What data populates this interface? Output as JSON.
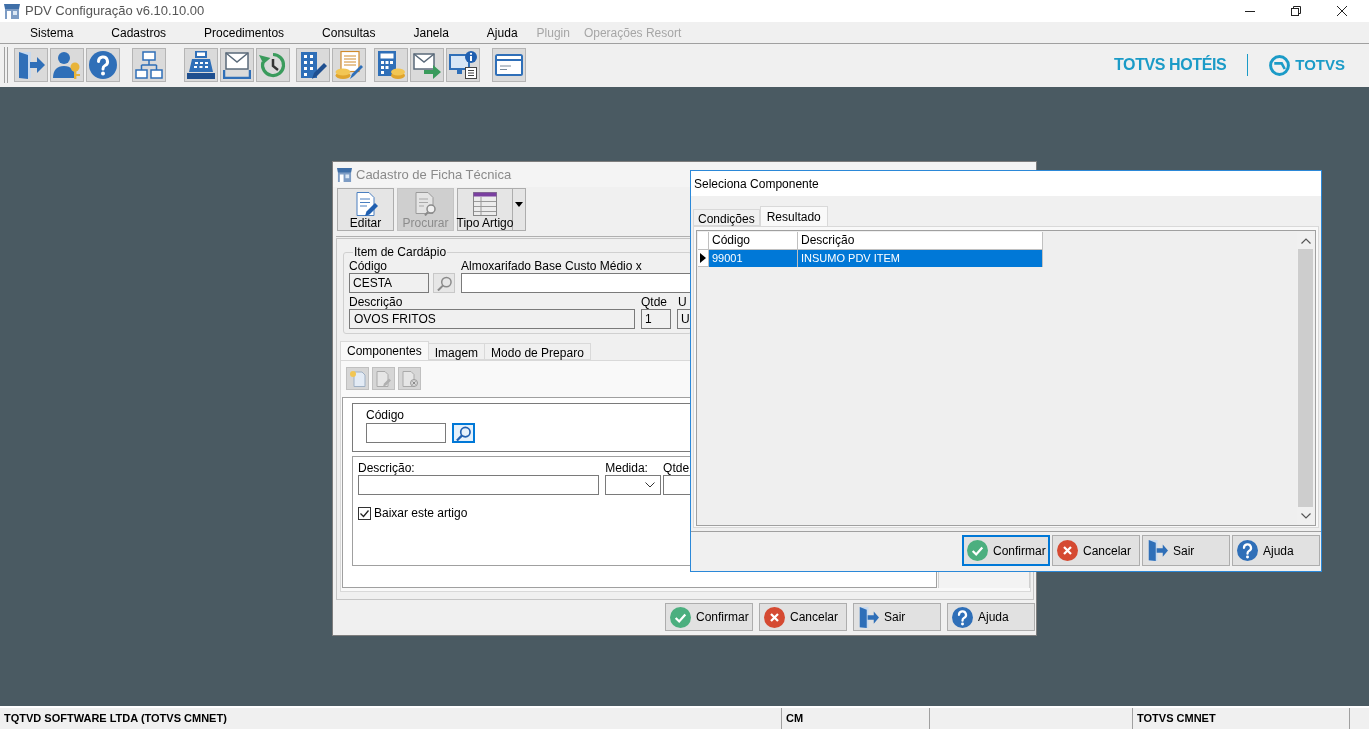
{
  "app_window": {
    "title": "PDV Configuração v6.10.10.00"
  },
  "menu": [
    {
      "label": "Sistema",
      "disabled": false
    },
    {
      "label": "Cadastros",
      "disabled": false
    },
    {
      "label": "Procedimentos",
      "disabled": false
    },
    {
      "label": "Consultas",
      "disabled": false
    },
    {
      "label": "Janela",
      "disabled": false
    },
    {
      "label": "Ajuda",
      "disabled": false
    },
    {
      "label": "Plugin",
      "disabled": true
    },
    {
      "label": "Operações Resort",
      "disabled": true
    }
  ],
  "brand": {
    "product": "TOTVS HOTÉIS",
    "company": "TOTVS"
  },
  "ficha_window": {
    "title": "Cadastro de Ficha Técnica",
    "active": false,
    "toolbar": [
      {
        "label": "Editar",
        "kind": "edit",
        "disabled": false
      },
      {
        "label": "Procurar",
        "kind": "search",
        "disabled": true
      },
      {
        "label": "Tipo Artigo",
        "kind": "dropdown",
        "disabled": false
      }
    ],
    "item_group": {
      "legend": "Item de Cardápio",
      "codigo": {
        "label": "Código",
        "value": "CESTA"
      },
      "almoxarifado": {
        "label": "Almoxarifado Base Custo Médio x"
      },
      "descricao": {
        "label": "Descrição",
        "value": "OVOS FRITOS"
      },
      "qtde": {
        "label": "Qtde",
        "value": "1"
      },
      "field_5": {
        "label": "U",
        "value": "U"
      }
    },
    "tabs": [
      {
        "label": "Componentes",
        "selected": true
      },
      {
        "label": "Imagem",
        "selected": false
      },
      {
        "label": "Modo de Preparo",
        "selected": false
      }
    ],
    "componentes": {
      "codigo": {
        "label": "Código",
        "search_focused": true
      },
      "descricao": {
        "label": "Descrição:"
      },
      "medida": {
        "label": "Medida:"
      },
      "qtde": {
        "label": "Qtde"
      },
      "baixar": {
        "label": "Baixar este artigo",
        "checked": true
      }
    },
    "buttons": [
      {
        "label": "Confirmar",
        "kind": "confirm"
      },
      {
        "label": "Cancelar",
        "kind": "cancel"
      },
      {
        "label": "Sair",
        "kind": "exit"
      },
      {
        "label": "Ajuda",
        "kind": "help"
      }
    ]
  },
  "selector_window": {
    "title": "Seleciona Componente",
    "active": true,
    "tabs": [
      {
        "label": "Condições",
        "selected": false
      },
      {
        "label": "Resultado",
        "selected": true
      }
    ],
    "table": {
      "columns": [
        "Código",
        "Descrição"
      ],
      "rows": [
        {
          "cells": [
            "99001",
            "INSUMO PDV ITEM"
          ],
          "selected": true
        }
      ]
    },
    "buttons": [
      {
        "label": "Confirmar",
        "kind": "confirm",
        "focused": true
      },
      {
        "label": "Cancelar",
        "kind": "cancel",
        "focused": false
      },
      {
        "label": "Sair",
        "kind": "exit",
        "focused": false
      },
      {
        "label": "Ajuda",
        "kind": "help",
        "focused": false
      }
    ]
  },
  "status_bar": {
    "panels": [
      "TQTVD SOFTWARE LTDA (TOTVS CMNET)",
      "CM",
      "TOTVS CMNET"
    ]
  }
}
